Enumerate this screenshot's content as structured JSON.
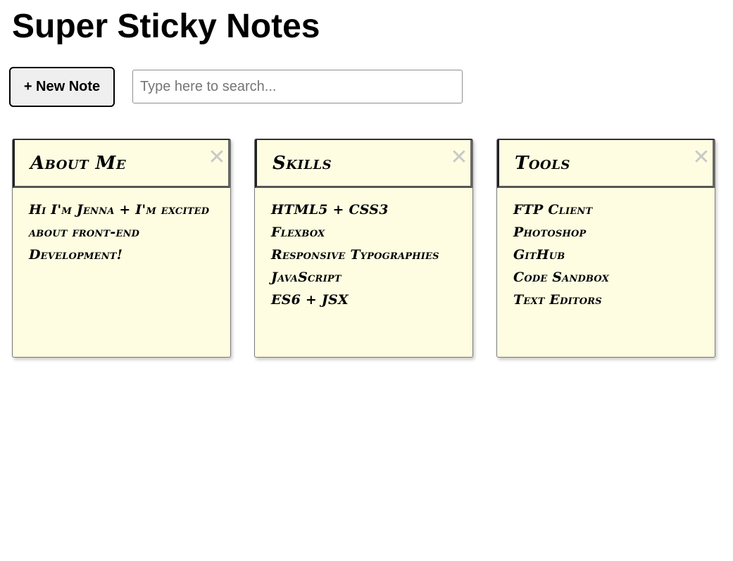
{
  "app": {
    "title": "Super Sticky Notes"
  },
  "toolbar": {
    "new_note_label": "+ New Note",
    "search_placeholder": "Type here to search...",
    "search_value": ""
  },
  "notes": [
    {
      "title": "About Me",
      "body": "Hi I'm Jenna + I'm excited about front-end Development!",
      "close_label": "✕",
      "close_icon": "close-icon"
    },
    {
      "title": "Skills",
      "body": "HTML5 + CSS3\nFlexbox\nResponsive Typographies\nJavaScript\nES6 + JSX",
      "close_label": "✕",
      "close_icon": "close-icon"
    },
    {
      "title": "Tools",
      "body": "FTP Client\nPhotoshop\nGitHub\nCode Sandbox\nText Editors",
      "close_label": "✕",
      "close_icon": "close-icon"
    }
  ],
  "colors": {
    "note_background": "#fefde1",
    "close_icon": "#c9c9c9",
    "button_background": "#efefef"
  }
}
